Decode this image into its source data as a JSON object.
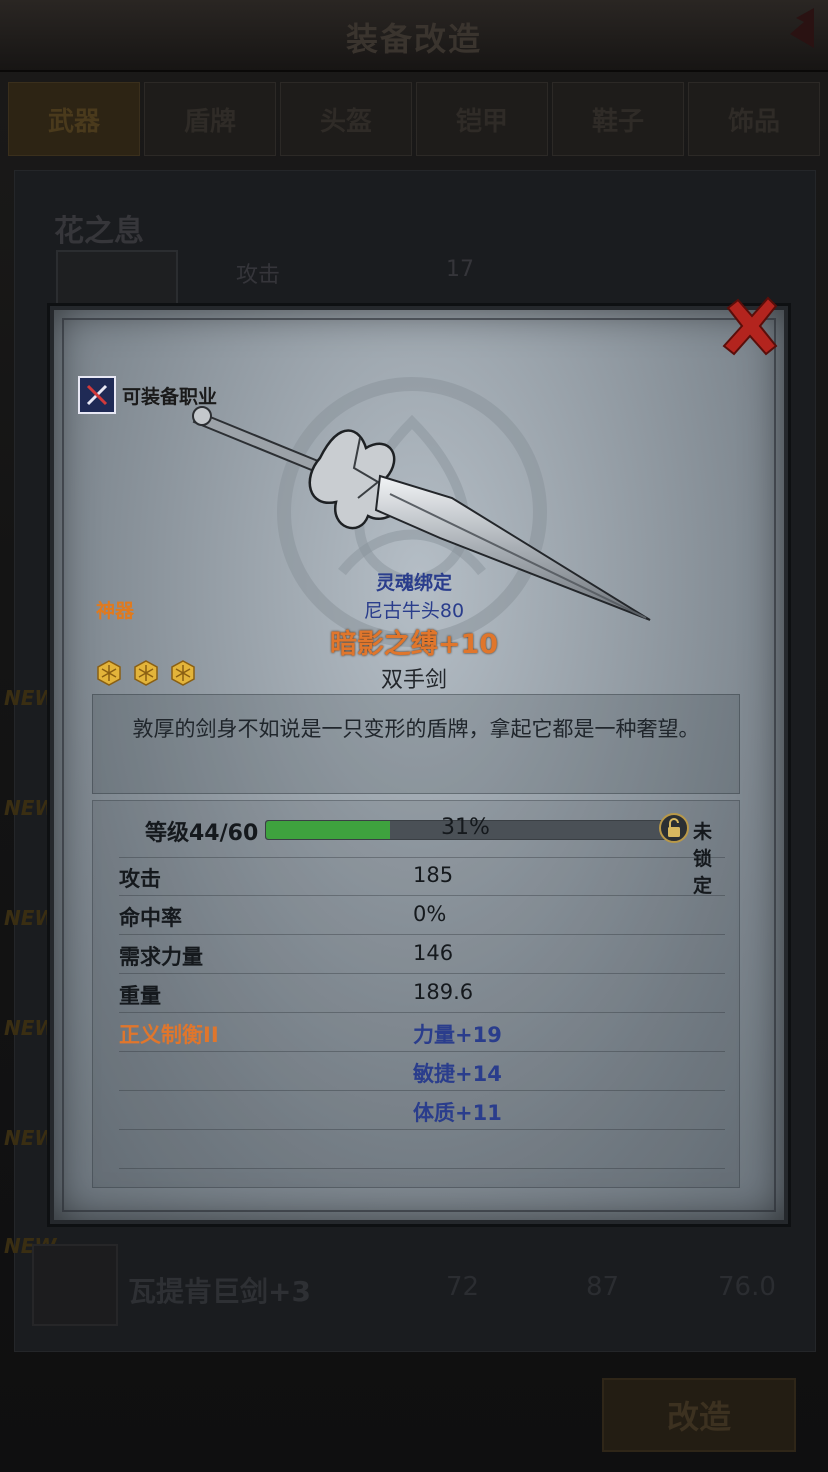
{
  "background": {
    "title": "装备改造",
    "tabs": [
      "武器",
      "盾牌",
      "头盔",
      "铠甲",
      "鞋子",
      "饰品"
    ],
    "active_tab": 0,
    "item_name": "花之息",
    "stat_label": "攻击",
    "stat_value": "17",
    "new_tag": "NEW",
    "row_name": "瓦提肯巨剑+3",
    "row_values": [
      "72",
      "87",
      "76.0"
    ],
    "action_button": "改造"
  },
  "modal": {
    "class_label": "可装备职业",
    "grade": "神器",
    "stars": 3,
    "binding": "灵魂绑定",
    "owner": "尼古牛头80",
    "name": "暗影之缚+10",
    "type": "双手剑",
    "description": "敦厚的剑身不如说是一只变形的盾牌，拿起它都是一种奢望。",
    "level_label": "等级44/60",
    "level_progress": 0.31,
    "level_pct": "31%",
    "lock_text": "未锁定",
    "stats": [
      {
        "label": "攻击",
        "value": "185"
      },
      {
        "label": "命中率",
        "value": "0%"
      },
      {
        "label": "需求力量",
        "value": "146"
      },
      {
        "label": "重量",
        "value": "189.6"
      }
    ],
    "set_name": "正义制衡II",
    "set_bonuses": [
      "力量+19",
      "敏捷+14",
      "体质+11"
    ]
  },
  "colors": {
    "accent_orange": "#e0762c",
    "blue_text": "#2a3d8c",
    "progress_green": "#3ea23e"
  }
}
